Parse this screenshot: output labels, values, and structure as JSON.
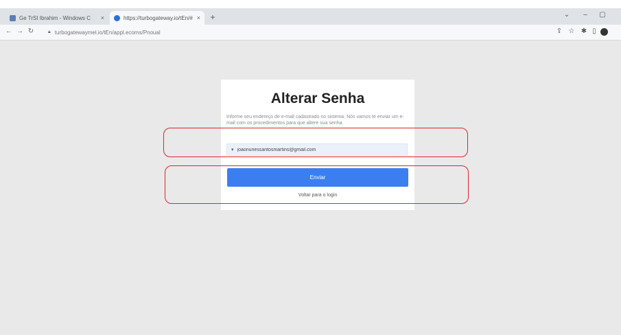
{
  "browser": {
    "tabs": [
      {
        "title": "Ge TrSI Ibrahim - Windows C",
        "active": false,
        "favicon_color": "#5b7fb5"
      },
      {
        "title": "https://turbogateway.io/tEn/#",
        "active": true,
        "favicon_color": "#2a72d8"
      }
    ],
    "new_tab_glyph": "+",
    "url": "turbogatewaymel.io/tEn/appl.ecoms/Pnoual",
    "window_controls": {
      "chevron": "⌄",
      "minimize": "–",
      "maximize": "▢"
    },
    "nav": {
      "back": "←",
      "forward": "→",
      "reload": "↻"
    },
    "toolbar_icons": [
      "share-icon",
      "star-icon",
      "extension-icon",
      "sidebar-icon",
      "profile-icon"
    ]
  },
  "page": {
    "title": "Alterar Senha",
    "description": "Informe seu endereço de e-mail cadastrado no sistema. Nós vamos te enviar um e-mail com os procedimentos para que altere sua senha.",
    "email_field": {
      "value": "joaonunessantosmartins@gmail.com",
      "icon": "mail-icon"
    },
    "submit_label": "Enviar",
    "back_link": "Voltar para o login"
  },
  "colors": {
    "primary_button": "#3b7ef0",
    "highlight_box": "#d9262c",
    "page_background": "#e9e9e9"
  }
}
